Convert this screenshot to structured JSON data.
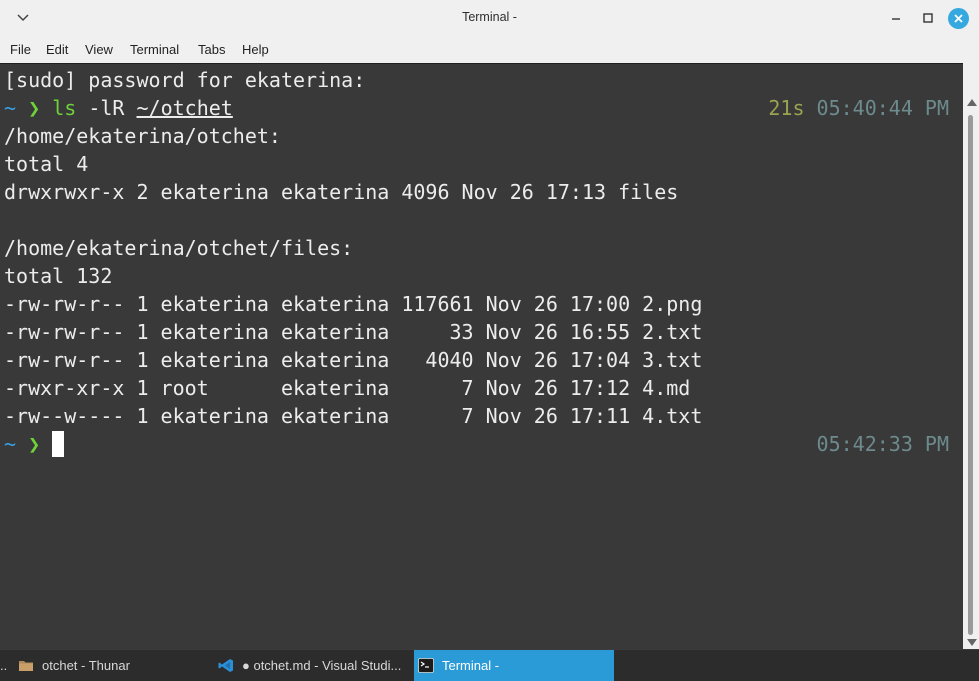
{
  "window": {
    "title": "Terminal -",
    "menu": [
      "File",
      "Edit",
      "View",
      "Terminal",
      "Tabs",
      "Help"
    ]
  },
  "terminal": {
    "line_sudo": "[sudo] password for ekaterina:",
    "prompt_tilde": "~",
    "prompt_chevron": "❯",
    "cmd1": {
      "program": "ls",
      "flags": " -lR ",
      "path": "~/otchet",
      "duration": "21s",
      "time": "05:40:44 PM"
    },
    "output": [
      "/home/ekaterina/otchet:",
      "total 4",
      "drwxrwxr-x 2 ekaterina ekaterina 4096 Nov 26 17:13 files",
      "",
      "/home/ekaterina/otchet/files:",
      "total 132",
      "-rw-rw-r-- 1 ekaterina ekaterina 117661 Nov 26 17:00 2.png",
      "-rw-rw-r-- 1 ekaterina ekaterina     33 Nov 26 16:55 2.txt",
      "-rw-rw-r-- 1 ekaterina ekaterina   4040 Nov 26 17:04 3.txt",
      "-rwxr-xr-x 1 root      ekaterina      7 Nov 26 17:12 4.md",
      "-rw--w---- 1 ekaterina ekaterina      7 Nov 26 17:11 4.txt"
    ],
    "prompt2_time": "05:42:33 PM"
  },
  "taskbar": {
    "items": [
      {
        "label": "otchet - Thunar",
        "icon": "folder-icon"
      },
      {
        "label": "● otchet.md - Visual Studi...",
        "icon": "vscode-icon"
      },
      {
        "label": "Terminal -",
        "icon": "terminal-icon"
      }
    ],
    "leading": ".."
  },
  "colors": {
    "accent": "#2a9bd6",
    "terminal_bg": "#393939",
    "prompt_tilde": "#3aa0e6",
    "prompt_chevron": "#6fd23a",
    "duration": "#9aa34f",
    "time": "#6d8a8d"
  }
}
